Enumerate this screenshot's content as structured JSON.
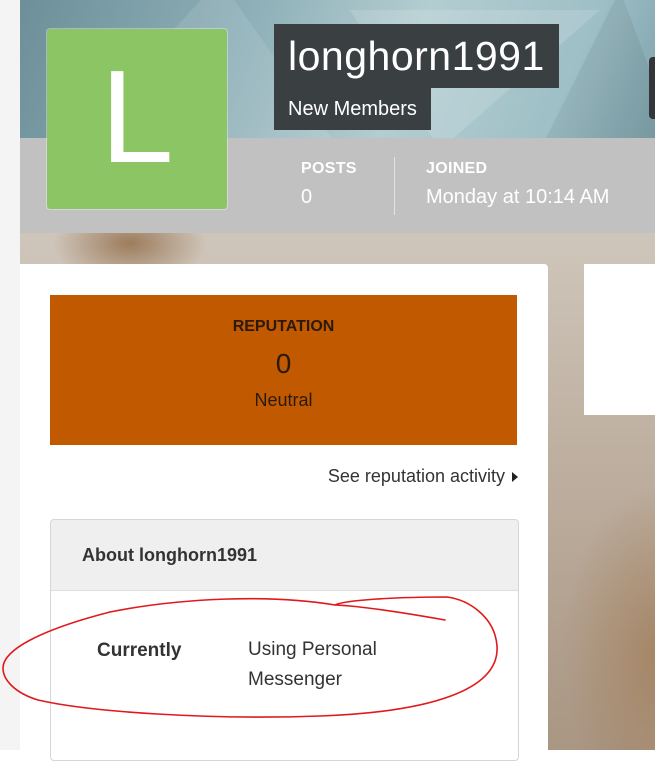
{
  "profile": {
    "avatar_letter": "L",
    "avatar_color": "#8bc564",
    "username": "longhorn1991",
    "member_group": "New Members"
  },
  "stats": {
    "posts_label": "POSTS",
    "posts_value": "0",
    "joined_label": "JOINED",
    "joined_value": "Monday at 10:14 AM"
  },
  "reputation": {
    "title": "REPUTATION",
    "value": "0",
    "level": "Neutral",
    "box_color": "#c15900",
    "activity_link": "See reputation activity"
  },
  "about": {
    "heading": "About longhorn1991",
    "fields": [
      {
        "key": "Currently",
        "value": "Using Personal Messenger"
      }
    ]
  },
  "annotation": {
    "type": "hand-drawn ellipse",
    "color": "#e0191c"
  }
}
